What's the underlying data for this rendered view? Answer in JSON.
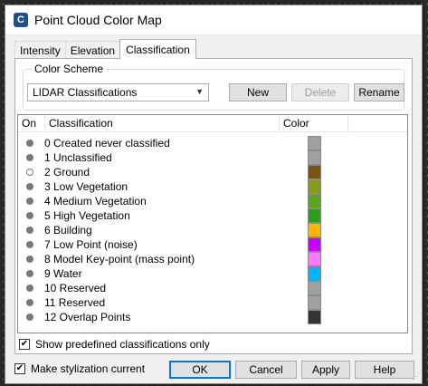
{
  "window": {
    "title": "Point Cloud Color Map",
    "icon": "app-c-icon"
  },
  "tabs": [
    {
      "label": "Intensity",
      "active": false
    },
    {
      "label": "Elevation",
      "active": false
    },
    {
      "label": "Classification",
      "active": true
    }
  ],
  "color_scheme": {
    "group_label": "Color Scheme",
    "selected": "LIDAR Classifications",
    "new_label": "New",
    "delete_label": "Delete",
    "rename_label": "Rename"
  },
  "table": {
    "headers": {
      "on": "On",
      "classification": "Classification",
      "color": "Color"
    },
    "rows": [
      {
        "label": "0 Created never classified",
        "on": true,
        "color": "#a0a0a0"
      },
      {
        "label": "1 Unclassified",
        "on": true,
        "color": "#a0a0a0"
      },
      {
        "label": "2 Ground",
        "on": false,
        "color": "#7a5310"
      },
      {
        "label": "3 Low Vegetation",
        "on": true,
        "color": "#8a9a1a"
      },
      {
        "label": "4 Medium Vegetation",
        "on": true,
        "color": "#5aa61c"
      },
      {
        "label": "5 High Vegetation",
        "on": true,
        "color": "#2aa01a"
      },
      {
        "label": "6 Building",
        "on": true,
        "color": "#ffb400"
      },
      {
        "label": "7 Low Point (noise)",
        "on": true,
        "color": "#c800ff"
      },
      {
        "label": "8 Model Key-point (mass point)",
        "on": true,
        "color": "#ff78ff"
      },
      {
        "label": "9 Water",
        "on": true,
        "color": "#00b4ff"
      },
      {
        "label": "10 Reserved",
        "on": true,
        "color": "#a0a0a0"
      },
      {
        "label": "11 Reserved",
        "on": true,
        "color": "#a0a0a0"
      },
      {
        "label": "12 Overlap Points",
        "on": true,
        "color": "#333333"
      }
    ]
  },
  "show_predefined": {
    "label": "Show predefined classifications only",
    "checked": true
  },
  "make_current": {
    "label": "Make stylization current",
    "checked": true
  },
  "buttons": {
    "ok": "OK",
    "cancel": "Cancel",
    "apply": "Apply",
    "help": "Help"
  },
  "colors": {
    "accent": "#0078d7"
  }
}
